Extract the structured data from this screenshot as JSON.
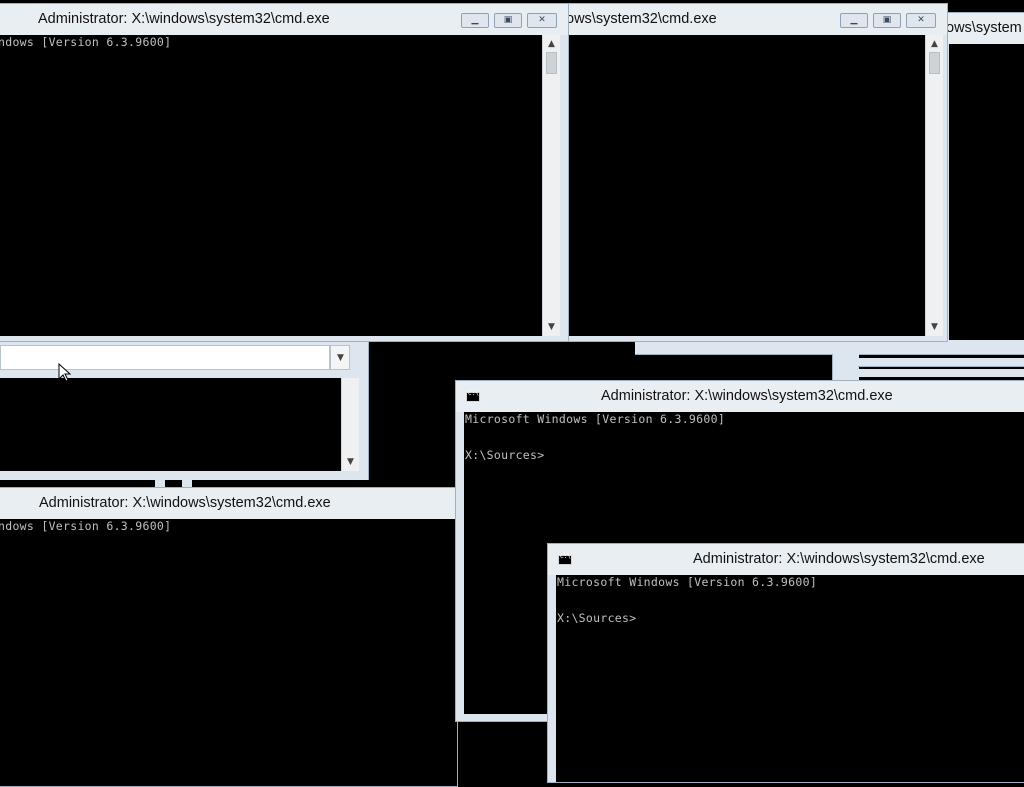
{
  "windows": {
    "tl": {
      "title": "Administrator: X:\\windows\\system32\\cmd.exe",
      "lines": [
        "ndows [Version 6.3.9600]"
      ]
    },
    "tr": {
      "title": "ows\\system32\\cmd.exe"
    },
    "far": {
      "title": "ows\\system"
    },
    "bl": {
      "title": "Administrator: X:\\windows\\system32\\cmd.exe",
      "lines": [
        "ndows [Version 6.3.9600]"
      ]
    },
    "mid": {
      "title": "Administrator: X:\\windows\\system32\\cmd.exe",
      "lines": [
        "Microsoft Windows [Version 6.3.9600]",
        "X:\\Sources>"
      ]
    },
    "front": {
      "title": "Administrator: X:\\windows\\system32\\cmd.exe",
      "lines": [
        "Microsoft Windows [Version 6.3.9600]",
        "X:\\Sources>"
      ]
    }
  },
  "icons": {
    "minimize": "minimize-icon",
    "maximize": "maximize-icon",
    "close": "close-icon",
    "arrow_up": "up-arrow-icon",
    "arrow_down": "down-arrow-icon",
    "console": "cmd-icon"
  },
  "glyphs": {
    "minimize": "▁",
    "maximize": "▣",
    "close": "✕",
    "up": "▲",
    "down": "▼"
  },
  "colors": {
    "console_bg": "#000000",
    "console_text": "#c0c0c0",
    "frame": "#dde6ee"
  }
}
